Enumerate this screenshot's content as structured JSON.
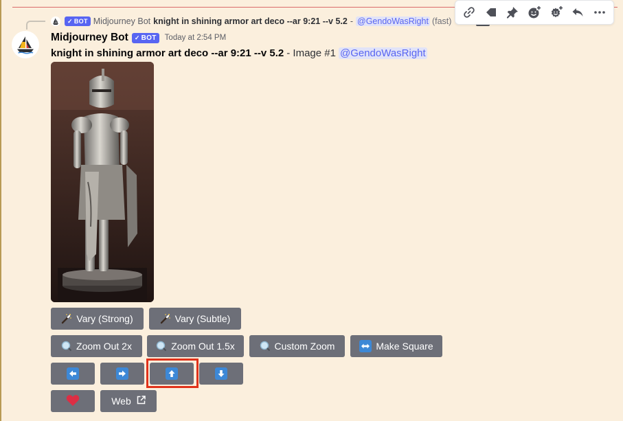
{
  "reply": {
    "bot_tag": "BOT",
    "author": "Midjourney Bot",
    "text": "knight in shining armor art deco --ar 9:21 --v 5.2",
    "dash": "-",
    "mention": "@GendoWasRight",
    "tail": "(fast)"
  },
  "message": {
    "author": "Midjourney Bot",
    "bot_tag": "BOT",
    "timestamp": "Today at 2:54 PM",
    "prompt": "knight in shining armor art deco --ar 9:21 --v 5.2",
    "suffix": "- Image #1",
    "mention": "@GendoWasRight"
  },
  "buttons": {
    "vary_strong": "Vary (Strong)",
    "vary_subtle": "Vary (Subtle)",
    "zoom_out_2x": "Zoom Out 2x",
    "zoom_out_1_5x": "Zoom Out 1.5x",
    "custom_zoom": "Custom Zoom",
    "make_square": "Make Square",
    "web": "Web"
  },
  "toolbar_icons": [
    "link-icon",
    "tag-icon",
    "pin-icon",
    "add-reaction-icon",
    "add-super-reaction-icon",
    "reply-icon",
    "more-icon"
  ],
  "colors": {
    "message_bg": "#fbefdd",
    "button_bg": "#6d6f78",
    "bot_tag": "#5865f2",
    "mention_bg": "#e1e3f8",
    "arrow_blue": "#3d88d6",
    "highlight": "#e0321a",
    "heart": "#dd2e44"
  }
}
